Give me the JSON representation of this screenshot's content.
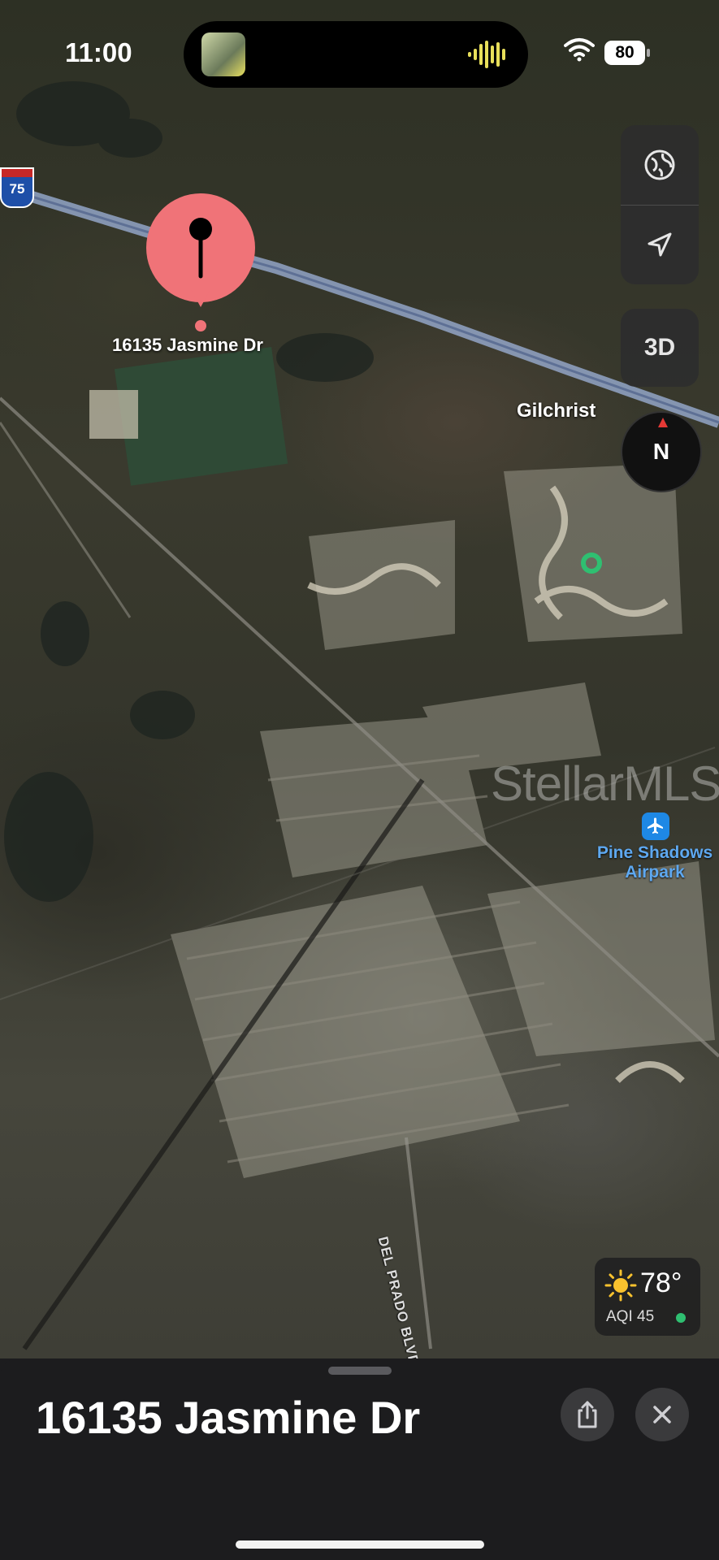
{
  "status_bar": {
    "time": "11:00",
    "battery": "80"
  },
  "map": {
    "pin_label": "16135 Jasmine Dr",
    "place_label": "Gilchrist",
    "highway_shield": "75",
    "watermark": "StellarMLS",
    "airport_label": "Pine Shadows Airpark",
    "road_label": "DEL PRADO BLVD N"
  },
  "controls": {
    "map_mode_icon": "globe-icon",
    "location_icon": "location-arrow-icon",
    "view_3d_label": "3D",
    "compass_label": "N"
  },
  "weather": {
    "temperature": "78°",
    "aqi_label": "AQI 45",
    "aqi_color": "#2fbf71",
    "icon": "sun-icon"
  },
  "sheet": {
    "title": "16135 Jasmine Dr",
    "share_icon": "share-icon",
    "close_icon": "close-icon"
  },
  "colors": {
    "pin": "#f07378",
    "route": "#9fb4dc",
    "airport": "#1e88e5"
  }
}
